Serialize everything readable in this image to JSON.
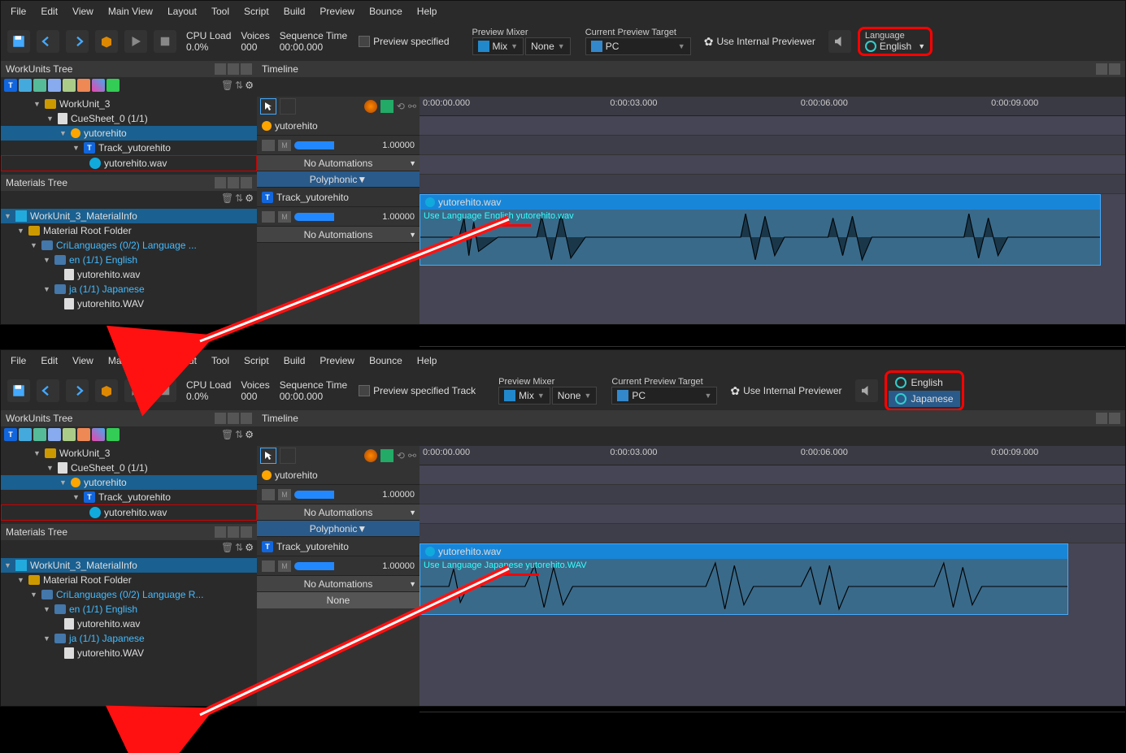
{
  "menu": [
    "File",
    "Edit",
    "View",
    "Main View",
    "Layout",
    "Tool",
    "Script",
    "Build",
    "Preview",
    "Bounce",
    "Help"
  ],
  "toolbar": {
    "cpu_load_label": "CPU Load",
    "cpu_load_val": "0.0%",
    "voices_label": "Voices",
    "voices_val": "000",
    "seq_time_label": "Sequence Time",
    "seq_time_val": "00:00.000",
    "preview_specified": "Preview specified",
    "preview_specified_track": "Preview specified Track",
    "preview_mixer_label": "Preview Mixer",
    "mix": "Mix",
    "none": "None",
    "cur_target_label": "Current Preview Target",
    "pc": "PC",
    "use_internal": "Use Internal Previewer",
    "language_label": "Language",
    "language_val": "English"
  },
  "lang_menu": {
    "en": "English",
    "ja": "Japanese"
  },
  "panes": {
    "workunits": "WorkUnits Tree",
    "materials": "Materials Tree",
    "timeline": "Timeline"
  },
  "tree": {
    "wu3": "WorkUnit_3",
    "cuesheet": "CueSheet_0 (1/1)",
    "cue": "yutorehito",
    "track": "Track_yutorehito",
    "wav": "yutorehito.wav",
    "wav_u": "yutorehito.WAV",
    "matinfo": "WorkUnit_3_MaterialInfo",
    "rootfolder": "Material Root Folder",
    "crilang": "CriLanguages (0/2) Language ...",
    "crilang_r": "CriLanguages (0/2) Language R...",
    "en": "en (1/1) English",
    "ja": "ja (1/1) Japanese"
  },
  "timeline": {
    "ticks": [
      "0:00:00.000",
      "0:00:03.000",
      "0:00:06.000",
      "0:00:09.000"
    ],
    "cue": "yutorehito",
    "track": "Track_yutorehito",
    "vol": "1.00000",
    "no_auto": "No Automations",
    "poly": "Polyphonic",
    "none": "None",
    "clip": "yutorehito.wav",
    "ann_en": "Use Language English yutorehito.wav",
    "ann_ja": "Use Language Japanese yutorehito.WAV"
  }
}
